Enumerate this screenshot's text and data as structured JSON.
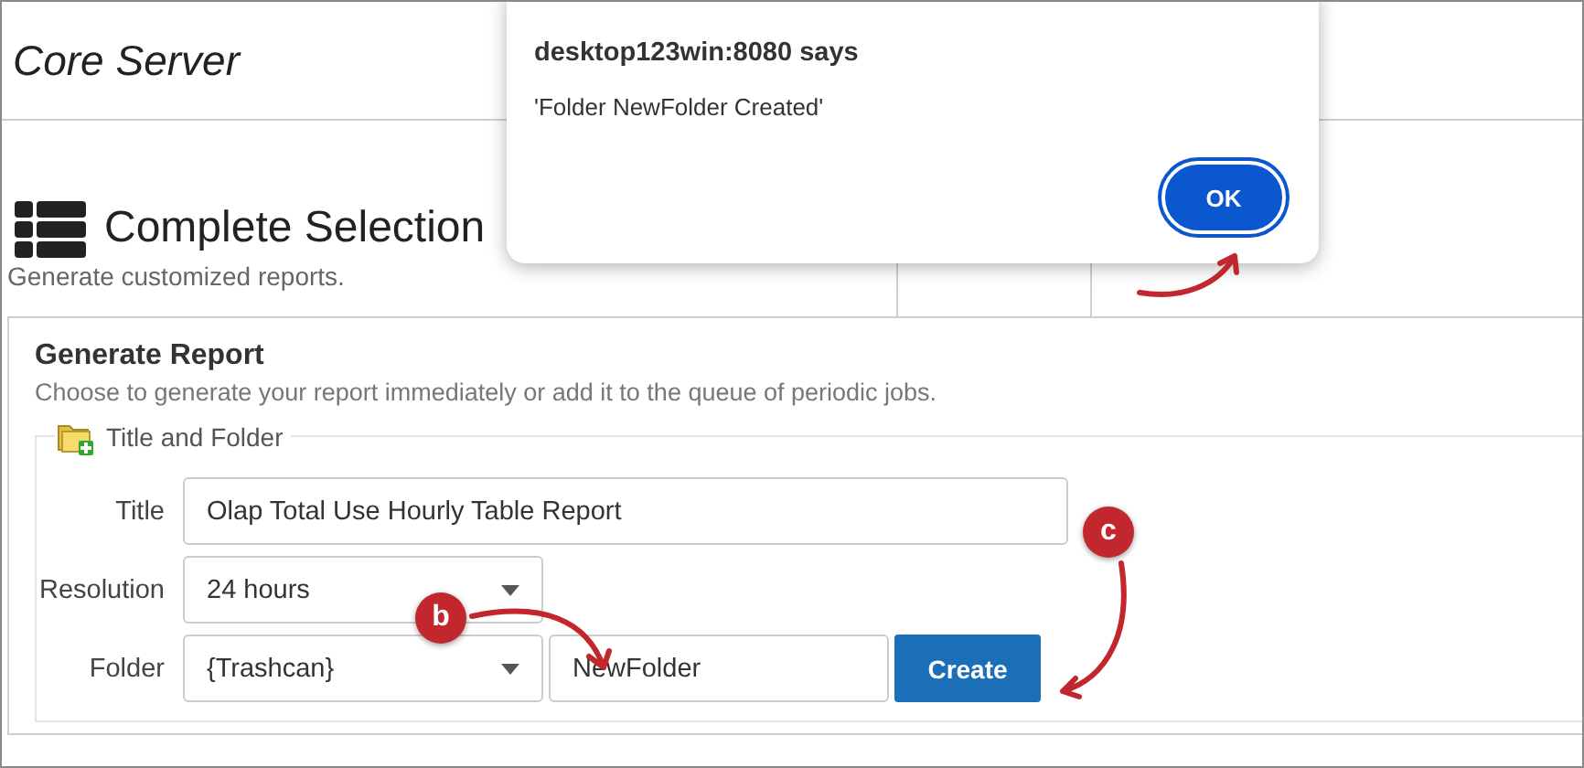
{
  "header": {
    "title": "Core Server"
  },
  "page": {
    "title": "Complete Selection",
    "subtitle": "Generate customized reports."
  },
  "report": {
    "title": "Generate Report",
    "description": "Choose to generate your report immediately or add it to the queue of periodic jobs.",
    "group": {
      "legend": "Title and Folder",
      "title_label": "Title",
      "title_value": "Olap Total Use Hourly Table Report",
      "resolution_label": "Resolution",
      "resolution_value": "24 hours",
      "folder_label": "Folder",
      "folder_value": "{Trashcan}",
      "new_folder_value": "NewFolder",
      "create_button": "Create"
    }
  },
  "dialog": {
    "title": "desktop123win:8080 says",
    "message": "'Folder NewFolder Created'",
    "ok_button": "OK"
  },
  "callouts": [
    {
      "label": "b"
    },
    {
      "label": "c"
    }
  ]
}
